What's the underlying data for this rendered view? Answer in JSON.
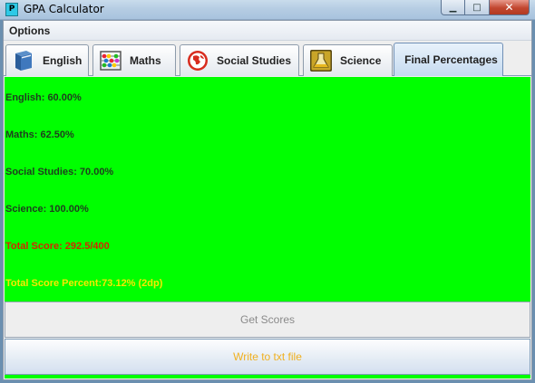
{
  "window": {
    "title": "GPA Calculator",
    "app_icon_letter": "P",
    "minimize_icon": "minimize-icon",
    "maximize_icon": "maximize-icon",
    "close_icon": "close-icon"
  },
  "menu": {
    "options_label": "Options"
  },
  "tabs": [
    {
      "label": "English",
      "icon": "book-icon",
      "selected": false
    },
    {
      "label": "Maths",
      "icon": "abacus-icon",
      "selected": false
    },
    {
      "label": "Social Studies",
      "icon": "globe-icon",
      "selected": false
    },
    {
      "label": "Science",
      "icon": "flask-icon",
      "selected": false
    },
    {
      "label": "Final Percentages",
      "icon": "",
      "selected": true
    }
  ],
  "results": {
    "english": "English: 60.00%",
    "maths": "Maths: 62.50%",
    "social_studies": "Social Studies: 70.00%",
    "science": "Science: 100.00%",
    "total_score": "Total Score: 292.5/400",
    "total_percent": "Total Score Percent:73.12% (2dp)"
  },
  "buttons": {
    "get_scores": "Get Scores",
    "write_file": "Write to txt file"
  },
  "colors": {
    "panel_bg": "#00ff00",
    "total_score_text": "#d22a00",
    "total_percent_text": "#f7e800",
    "write_button_text": "#f0b020"
  }
}
